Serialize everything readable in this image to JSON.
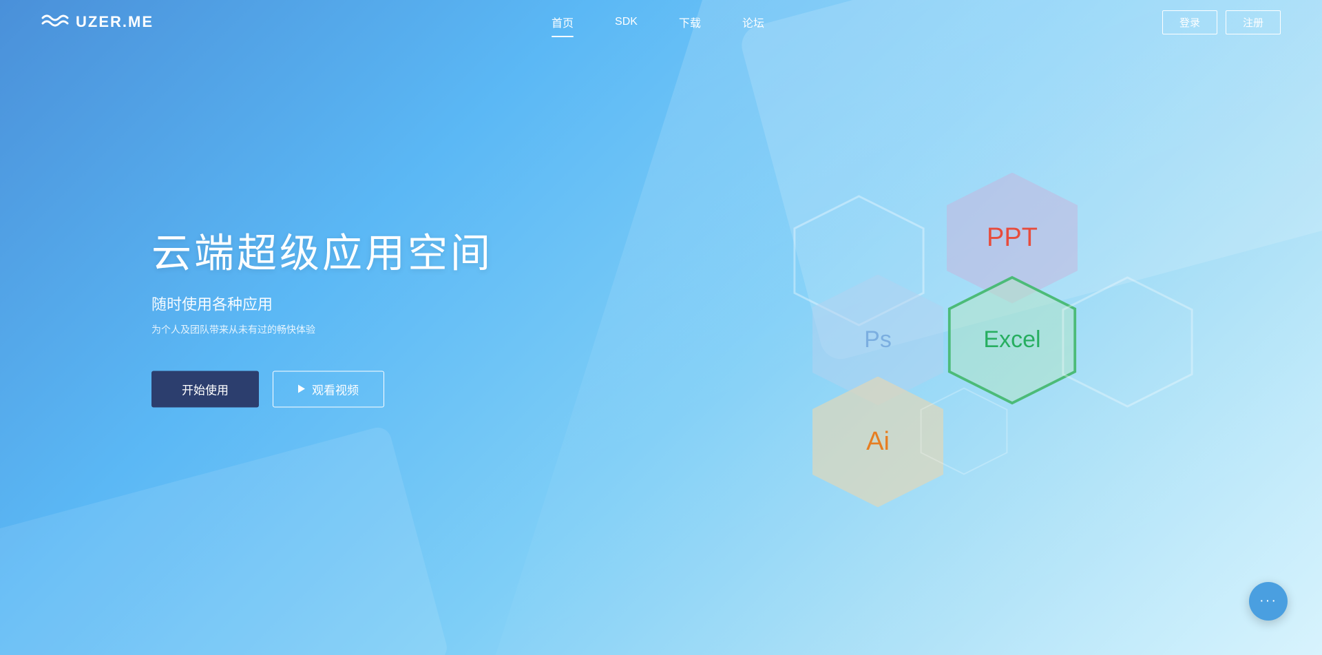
{
  "navbar": {
    "logo_text": "UZER.ME",
    "nav_items": [
      {
        "label": "首页",
        "active": true
      },
      {
        "label": "SDK",
        "active": false
      },
      {
        "label": "下载",
        "active": false
      },
      {
        "label": "论坛",
        "active": false
      }
    ],
    "login_label": "登录",
    "register_label": "注册"
  },
  "hero": {
    "title": "云端超级应用空间",
    "subtitle": "随时使用各种应用",
    "description": "为个人及团队带来从未有过的畅快体验",
    "btn_start": "开始使用",
    "btn_video": "观看视频"
  },
  "hexagons": [
    {
      "label": "PPT",
      "color": "#e74c3c",
      "bg": "rgba(200,180,220,0.5)"
    },
    {
      "label": "Ps",
      "color": "#7baee0",
      "bg": "rgba(180,210,240,0.5)"
    },
    {
      "label": "Excel",
      "color": "#27ae60",
      "bg": "rgba(180,230,195,0.5)"
    },
    {
      "label": "Ai",
      "color": "#e67e22",
      "bg": "rgba(235,215,175,0.6)"
    }
  ],
  "chat_button": {
    "dots": "···"
  }
}
